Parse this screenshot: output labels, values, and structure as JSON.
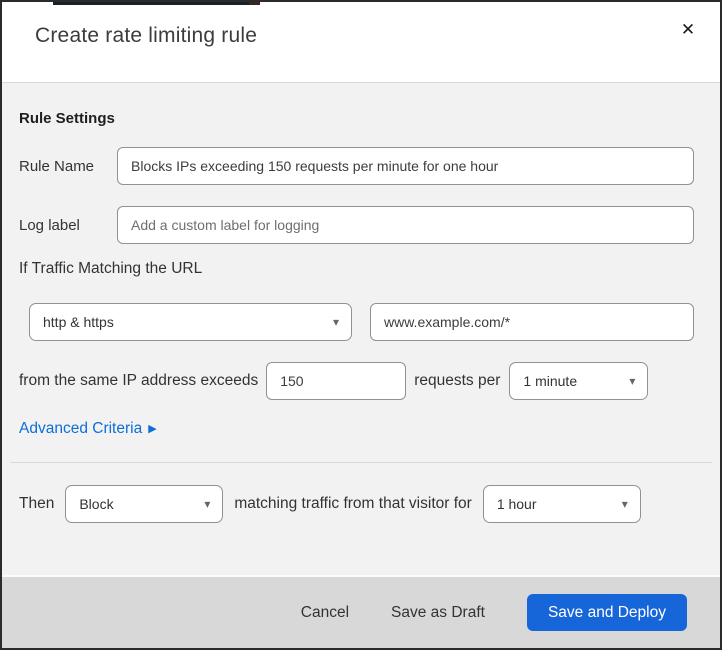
{
  "dialog": {
    "title": "Create rate limiting rule"
  },
  "icons": {
    "close": "✕",
    "caret_down": "▾",
    "arrow_right": "▶"
  },
  "rule_settings": {
    "heading": "Rule Settings",
    "rule_name_label": "Rule Name",
    "rule_name_value": "Blocks IPs exceeding 150 requests per minute for one hour",
    "log_label_label": "Log label",
    "log_label_placeholder": "Add a custom label for logging"
  },
  "criteria": {
    "heading": "If Traffic Matching the URL",
    "scheme_value": "http & https",
    "url_value": "www.example.com/*",
    "threshold_prefix": "from the same IP address exceeds",
    "requests_value": "150",
    "threshold_suffix": "requests per",
    "period_value": "1 minute",
    "advanced_label": "Advanced Criteria"
  },
  "action": {
    "then_label": "Then",
    "action_value": "Block",
    "middle_text": "matching traffic from that visitor for",
    "duration_value": "1 hour"
  },
  "footer": {
    "cancel": "Cancel",
    "save_draft": "Save as Draft",
    "save_deploy": "Save and Deploy"
  },
  "colors": {
    "accent_blue": "#0d6ed6",
    "button_blue": "#1766d9",
    "body_bg": "#f2f2f2",
    "footer_bg": "#d8d8d8",
    "border_gray": "#919191"
  }
}
